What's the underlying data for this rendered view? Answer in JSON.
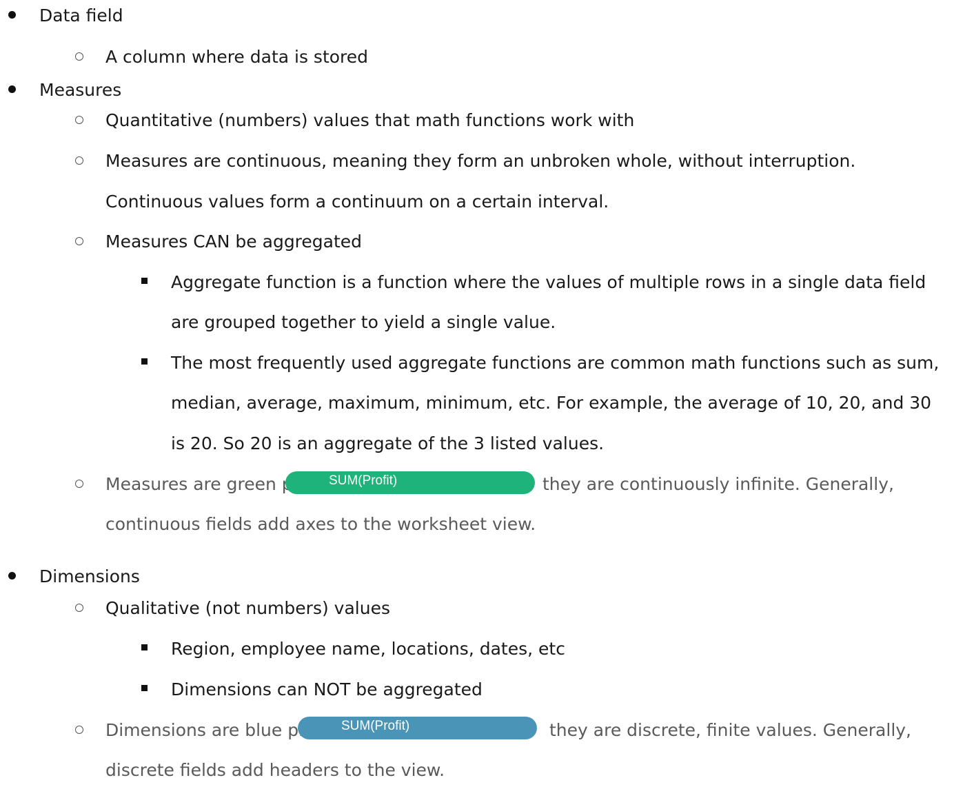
{
  "items": {
    "data_field": {
      "label": "Data field",
      "sub": "A column where data is stored"
    },
    "measures": {
      "label": "Measures",
      "sub1": "Quantitative (numbers) values that math functions work with",
      "sub2_line1": "Measures are continuous, meaning they form an unbroken whole, without interruption.",
      "sub2_line2": "Continuous values form a continuum on a certain interval.",
      "sub3": "Measures CAN be aggregated",
      "sub3_bullet1_line1": "Aggregate function is a function where the values of multiple rows in a single data field",
      "sub3_bullet1_line2": "are grouped together to yield a single value.",
      "sub3_bullet2_line1": "The most frequently used aggregate functions are common math functions such as sum,",
      "sub3_bullet2_line2": "median, average, maximum, minimum, etc. For example, the average of 10, 20, and 30",
      "sub3_bullet2_line3": "is 20. So 20 is an aggregate of the 3 listed values.",
      "sub4_before": "Measures are green pills",
      "sub4_pill": "SUM(Profit)",
      "sub4_after": "they are continuously infinite. Generally,",
      "sub4_line2": "continuous fields add axes to the worksheet view."
    },
    "dimensions": {
      "label": "Dimensions",
      "sub1": "Qualitative (not numbers) values",
      "sub1_bullet1": "Region, employee name, locations, dates, etc",
      "sub1_bullet2": "Dimensions can NOT be aggregated",
      "sub2_before": "Dimensions are blue pills",
      "sub2_pill": "SUM(Profit)",
      "sub2_after": "they are discrete, finite values. Generally,",
      "sub2_line2": "discrete fields add headers to the view."
    }
  },
  "colors": {
    "measure_pill": "#1db37a",
    "dimension_pill": "#4a94b7"
  }
}
